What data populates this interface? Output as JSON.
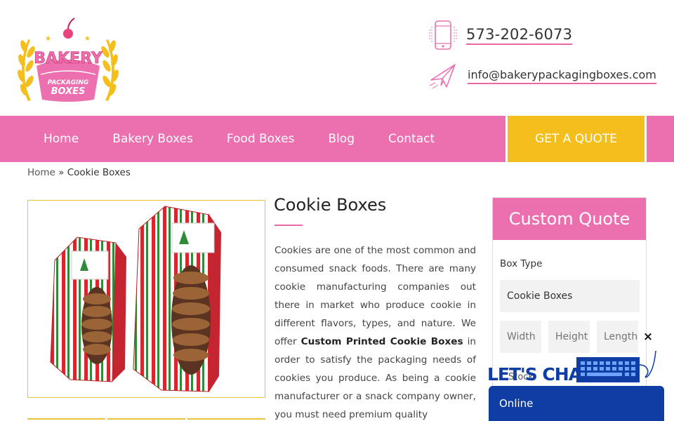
{
  "header": {
    "logo": {
      "top_text": "BAKERY",
      "middle_text": "PACKAGING",
      "bottom_text": "BOXES"
    },
    "phone": "573-202-6073",
    "email": "info@bakerypackagingboxes.com"
  },
  "nav": {
    "items": [
      "Home",
      "Bakery Boxes",
      "Food Boxes",
      "Blog",
      "Contact"
    ],
    "quote_button": "GET A QUOTE"
  },
  "breadcrumb": {
    "home": "Home",
    "separator": "»",
    "current": "Cookie Boxes"
  },
  "product": {
    "title": "Cookie Boxes",
    "desc_before": "Cookies are one of the most common and consumed snack foods. There are many cookie manufacturing companies out there in market who produce cookie in different flavors, types, and nature. We offer ",
    "desc_bold": "Custom Printed Cookie Boxes",
    "desc_after": " in order to satisfy the packaging needs of cookies you produce. As being a cookie manufacturer or a snack company owner, you must need premium quality"
  },
  "quote_form": {
    "heading": "Custom Quote",
    "box_type_label": "Box Type",
    "box_type_value": "Cookie Boxes",
    "width_placeholder": "Width",
    "height_placeholder": "Height",
    "length_placeholder": "Length",
    "stock_label": "Stock"
  },
  "chat": {
    "banner_text": "LET'S CHAT",
    "close_symbol": "×",
    "status": "Online"
  },
  "colors": {
    "pink": "#ec6fb0",
    "yellow": "#f4bf1d",
    "chat_blue": "#0e3ea3"
  }
}
